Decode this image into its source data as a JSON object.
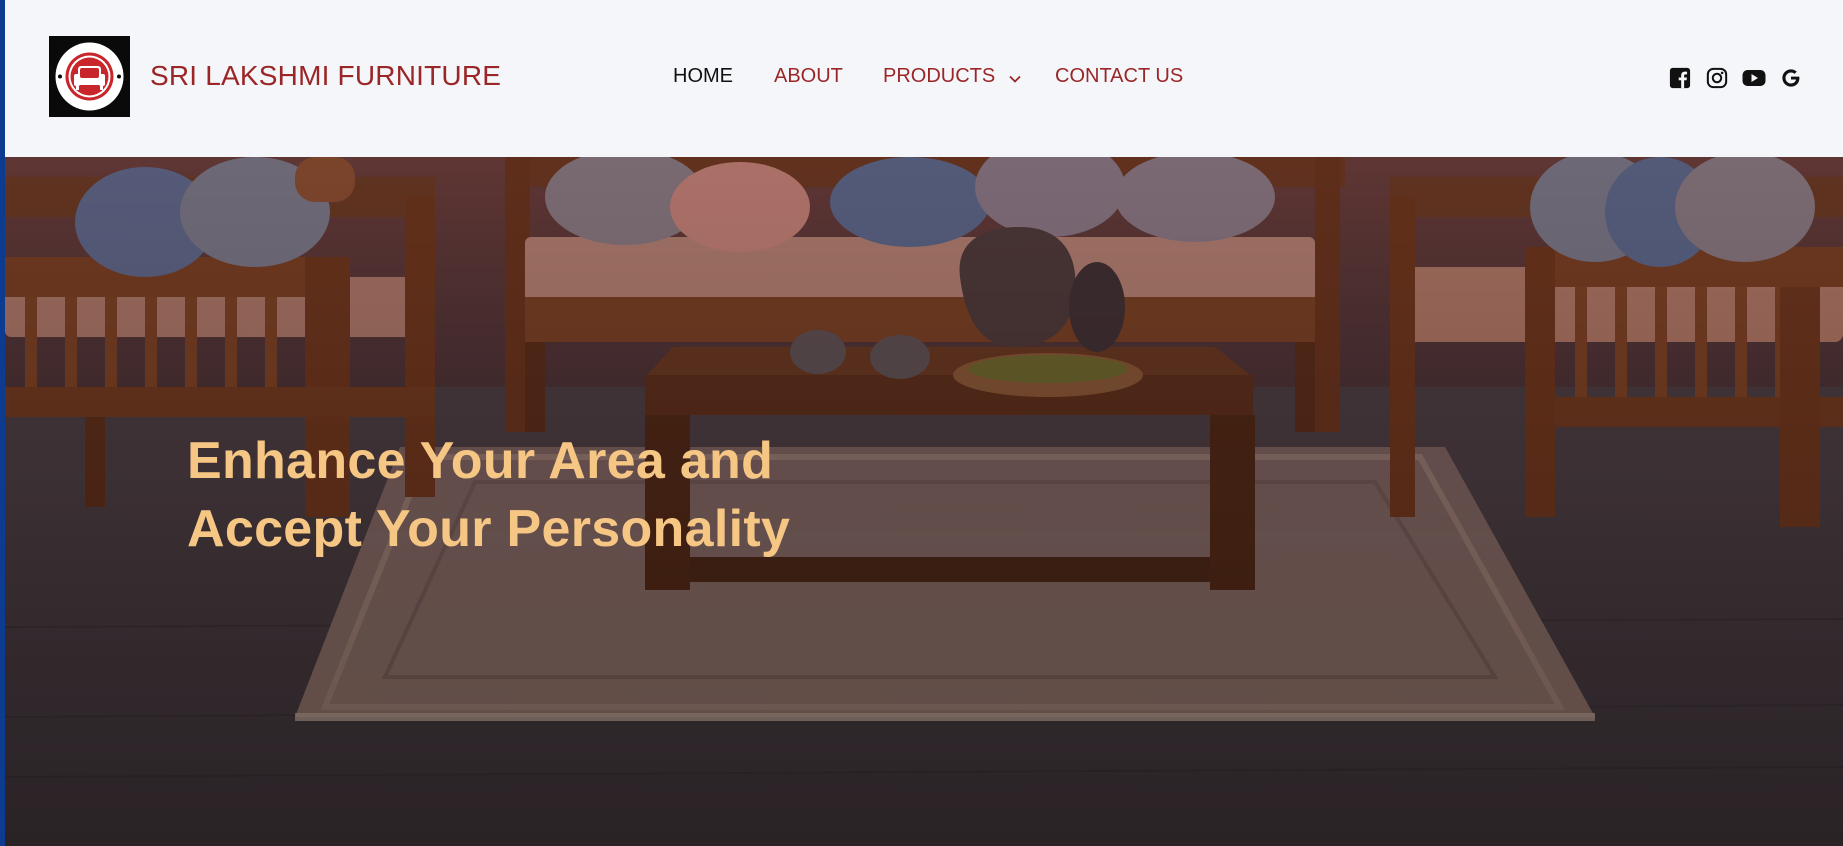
{
  "brand": {
    "name": "SRI LAKSHMI FURNITURE",
    "logo_text_top": "Sri Lakshmi Furniture",
    "logo_text_bottom": "Sri Lakshmi Furniture",
    "logo_icon": "armchair-icon"
  },
  "nav": {
    "items": [
      {
        "label": "HOME",
        "active": true
      },
      {
        "label": "ABOUT"
      },
      {
        "label": "PRODUCTS",
        "has_dropdown": true,
        "icon": "chevron-down-icon"
      },
      {
        "label": "CONTACT US"
      }
    ]
  },
  "social": [
    {
      "icon": "facebook-icon"
    },
    {
      "icon": "instagram-icon"
    },
    {
      "icon": "youtube-icon"
    },
    {
      "icon": "google-icon"
    }
  ],
  "hero": {
    "headline_line1": "Enhance Your Area and",
    "headline_line2": "Accept Your Personality",
    "image": "living-room-wooden-sofa-set"
  },
  "colors": {
    "brand": "#9b2627",
    "header_bg": "#f4f6f9",
    "headline": "#f6c784",
    "nav_active": "#111111"
  }
}
